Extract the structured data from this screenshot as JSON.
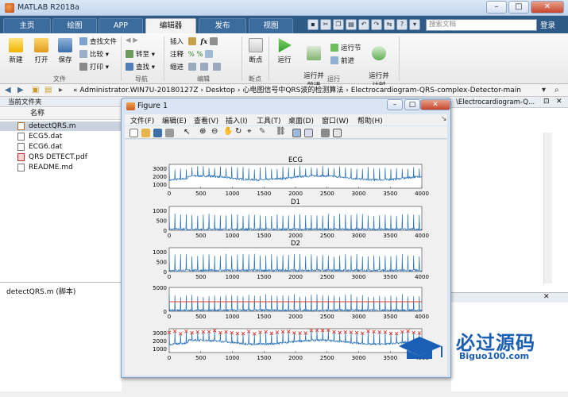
{
  "app": {
    "title": "MATLAB R2018a"
  },
  "ribbon_tabs": [
    "主页",
    "绘图",
    "APP",
    "编辑器",
    "发布",
    "视图"
  ],
  "active_tab": "编辑器",
  "search_placeholder": "搜索文档",
  "login_label": "登录",
  "ribbon": {
    "new_label": "新建",
    "open_label": "打开",
    "save_label": "保存",
    "find_files_label": "查找文件",
    "compare_label": "比较",
    "print_label": "打印",
    "group_file": "文件",
    "goto_label": "转至",
    "find_label": "查找",
    "group_nav": "导航",
    "insert_label": "插入",
    "comment_label": "注释",
    "indent_label": "缩进",
    "group_edit": "编辑",
    "breakpoint_label": "断点",
    "group_breakpoint": "断点",
    "run_label": "运行",
    "run_advance_label": "运行并\n前进",
    "run_section_label": "运行节",
    "advance_label": "前进",
    "run_time_label": "运行并\n计时",
    "group_run": "运行"
  },
  "address": {
    "path": "« Administrator.WIN7U-20180127Z › Desktop › 心电图信号中QRS波的检测算法 › Electrocardiogram-QRS-complex-Detector-main"
  },
  "current_folder": {
    "title": "当前文件夹",
    "column": "名称",
    "files": [
      {
        "name": "detectQRS.m",
        "selected": true
      },
      {
        "name": "ECG5.dat",
        "selected": false
      },
      {
        "name": "ECG6.dat",
        "selected": false
      },
      {
        "name": "QRS DETECT.pdf",
        "selected": false
      },
      {
        "name": "README.md",
        "selected": false
      }
    ],
    "detail_label": "detectQRS.m  (脚本)"
  },
  "right_pane_title": "\\Electrocardiogram-Q...",
  "figure": {
    "title": "Figure 1",
    "menus": [
      "文件(F)",
      "编辑(E)",
      "查看(V)",
      "插入(I)",
      "工具(T)",
      "桌面(D)",
      "窗口(W)",
      "帮助(H)"
    ]
  },
  "chart_data": [
    {
      "type": "line",
      "title": "ECG",
      "xlim": [
        0,
        4000
      ],
      "ylim": [
        500,
        3500
      ],
      "yticks": [
        1000,
        2000,
        3000
      ],
      "xticks": [
        0,
        500,
        1000,
        1500,
        2000,
        2500,
        3000,
        3500,
        4000
      ],
      "series": [
        {
          "color": "#2a72b8",
          "baseline": 1800,
          "spike": 2900,
          "wander": 500
        }
      ]
    },
    {
      "type": "line",
      "title": "D1",
      "xlim": [
        0,
        4000
      ],
      "ylim": [
        0,
        1200
      ],
      "yticks": [
        0,
        500,
        1000
      ],
      "xticks": [
        0,
        500,
        1000,
        1500,
        2000,
        2500,
        3000,
        3500,
        4000
      ],
      "series": [
        {
          "color": "#2a72b8",
          "baseline": 50,
          "spike": 700
        }
      ]
    },
    {
      "type": "line",
      "title": "D2",
      "xlim": [
        0,
        4000
      ],
      "ylim": [
        0,
        1200
      ],
      "yticks": [
        0,
        500,
        1000
      ],
      "xticks": [
        0,
        500,
        1000,
        1500,
        2000,
        2500,
        3000,
        3500,
        4000
      ],
      "series": [
        {
          "color": "#2a72b8",
          "baseline": 60,
          "spike": 750
        }
      ]
    },
    {
      "type": "line",
      "title": "",
      "xlim": [
        0,
        4000
      ],
      "ylim": [
        0,
        5000
      ],
      "yticks": [
        0,
        5000
      ],
      "xticks": [
        0,
        500,
        1000,
        1500,
        2000,
        2500,
        3000,
        3500,
        4000
      ],
      "threshold": 2000,
      "series": [
        {
          "color": "#2a72b8",
          "baseline": 200,
          "spike": 3000
        }
      ]
    },
    {
      "type": "line",
      "title": "",
      "xlim": [
        0,
        4000
      ],
      "ylim": [
        500,
        3500
      ],
      "yticks": [
        1000,
        2000,
        3000
      ],
      "xticks": [
        0,
        500,
        1000,
        1500,
        2000,
        2500,
        3000,
        3500,
        4000
      ],
      "markers": "x",
      "series": [
        {
          "color": "#2a72b8",
          "baseline": 1800,
          "spike": 2900,
          "wander": 500
        }
      ]
    }
  ],
  "watermark": {
    "text": "必过源码",
    "sub": "Biguo100.com"
  }
}
